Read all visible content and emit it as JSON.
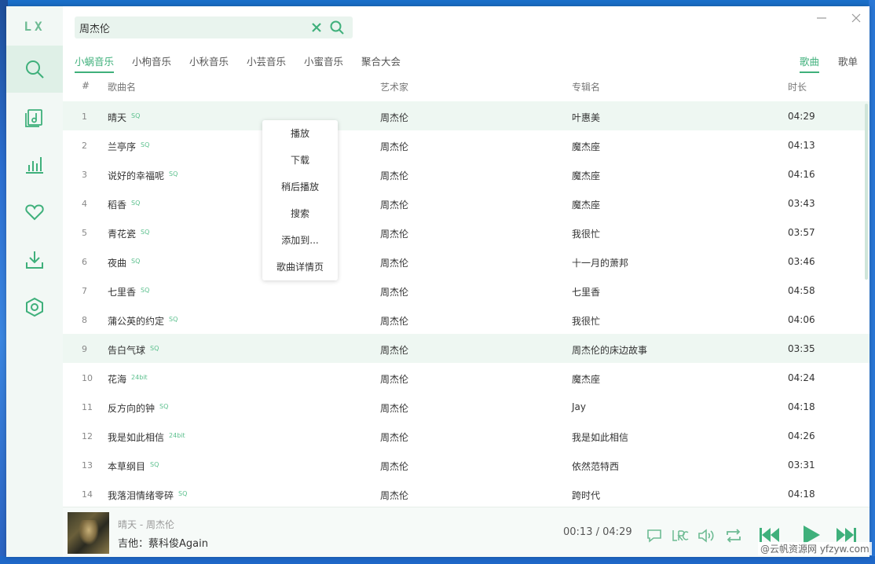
{
  "app": {
    "logo": "LX"
  },
  "sidebar": {
    "items": [
      {
        "icon": "search-icon",
        "active": true
      },
      {
        "icon": "music-list-icon"
      },
      {
        "icon": "chart-icon"
      },
      {
        "icon": "heart-icon"
      },
      {
        "icon": "download-icon"
      },
      {
        "icon": "settings-icon"
      }
    ]
  },
  "search": {
    "value": "周杰伦"
  },
  "sources": [
    "小蜗音乐",
    "小枸音乐",
    "小秋音乐",
    "小芸音乐",
    "小蜜音乐",
    "聚合大会"
  ],
  "active_source": "小蜗音乐",
  "type_tabs": [
    "歌曲",
    "歌单"
  ],
  "table": {
    "headers": {
      "num": "#",
      "name": "歌曲名",
      "artist": "艺术家",
      "album": "专辑名",
      "duration": "时长"
    },
    "rows": [
      {
        "num": "1",
        "name": "晴天",
        "quality": "SQ",
        "artist": "周杰伦",
        "album": "叶惠美",
        "duration": "04:29"
      },
      {
        "num": "2",
        "name": "兰亭序",
        "quality": "SQ",
        "artist": "周杰伦",
        "album": "魔杰座",
        "duration": "04:13"
      },
      {
        "num": "3",
        "name": "说好的幸福呢",
        "quality": "SQ",
        "artist": "周杰伦",
        "album": "魔杰座",
        "duration": "04:16"
      },
      {
        "num": "4",
        "name": "稻香",
        "quality": "SQ",
        "artist": "周杰伦",
        "album": "魔杰座",
        "duration": "03:43"
      },
      {
        "num": "5",
        "name": "青花瓷",
        "quality": "SQ",
        "artist": "周杰伦",
        "album": "我很忙",
        "duration": "03:57"
      },
      {
        "num": "6",
        "name": "夜曲",
        "quality": "SQ",
        "artist": "周杰伦",
        "album": "十一月的萧邦",
        "duration": "03:46"
      },
      {
        "num": "7",
        "name": "七里香",
        "quality": "SQ",
        "artist": "周杰伦",
        "album": "七里香",
        "duration": "04:58"
      },
      {
        "num": "8",
        "name": "蒲公英的约定",
        "quality": "SQ",
        "artist": "周杰伦",
        "album": "我很忙",
        "duration": "04:06"
      },
      {
        "num": "9",
        "name": "告白气球",
        "quality": "SQ",
        "artist": "周杰伦",
        "album": "周杰伦的床边故事",
        "duration": "03:35"
      },
      {
        "num": "10",
        "name": "花海",
        "quality": "24bit",
        "artist": "周杰伦",
        "album": "魔杰座",
        "duration": "04:24"
      },
      {
        "num": "11",
        "name": "反方向的钟",
        "quality": "SQ",
        "artist": "周杰伦",
        "album": "Jay",
        "duration": "04:18"
      },
      {
        "num": "12",
        "name": "我是如此相信",
        "quality": "24bit",
        "artist": "周杰伦",
        "album": "我是如此相信",
        "duration": "04:26"
      },
      {
        "num": "13",
        "name": "本草纲目",
        "quality": "SQ",
        "artist": "周杰伦",
        "album": "依然范特西",
        "duration": "03:31"
      },
      {
        "num": "14",
        "name": "我落泪情绪零碎",
        "quality": "SQ",
        "artist": "周杰伦",
        "album": "跨时代",
        "duration": "04:18"
      }
    ]
  },
  "context_menu": [
    "播放",
    "下载",
    "稍后播放",
    "搜索",
    "添加到...",
    "歌曲详情页"
  ],
  "player": {
    "title": "晴天 - 周杰伦",
    "lyric": "吉他：蔡科俊Again",
    "current_time": "00:13",
    "separator": "/",
    "total_time": "04:29"
  },
  "watermark": "@云帆资源网 yfzyw.com",
  "colors": {
    "accent": "#3fb07b",
    "sidebar_bg": "#f2f8f5",
    "highlight_row": "#eef7f2"
  }
}
